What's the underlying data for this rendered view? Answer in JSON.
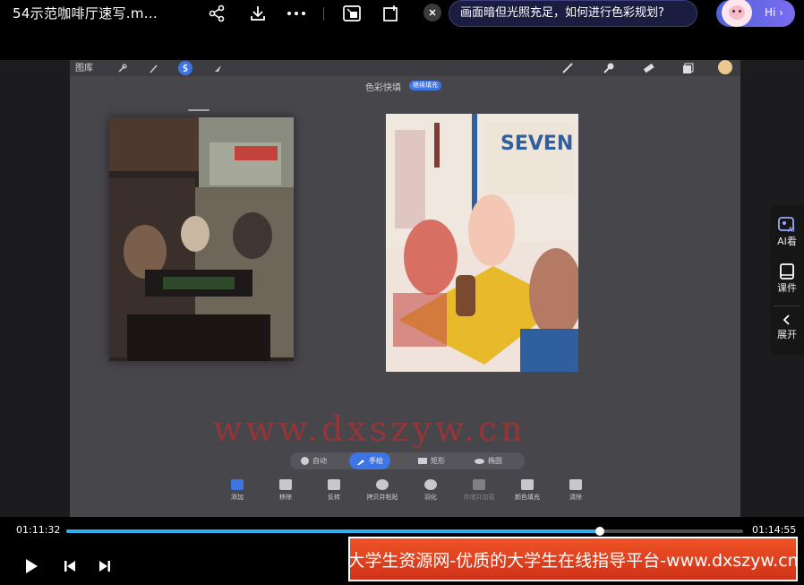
{
  "file_title": "54示范咖啡厅速写.m...",
  "toolbar_icons": [
    "share-icon",
    "download-icon",
    "more-icon",
    "crop-screen-icon",
    "rotate-icon"
  ],
  "ai_question": "画面暗但光照充足，如何进行色彩规划?",
  "hi_label": "Hi ›",
  "ipad": {
    "gallery_label": "图库",
    "heading": "色彩快填",
    "badge": "继续填充"
  },
  "watermark": "www.dxszyw.cn",
  "mode_bar": [
    {
      "label": "自动",
      "icon": "circle-icon"
    },
    {
      "label": "手绘",
      "icon": "pen-icon"
    },
    {
      "label": "矩形",
      "icon": "rectangle-icon"
    },
    {
      "label": "椭圆",
      "icon": "ellipse-icon"
    }
  ],
  "actions": [
    {
      "label": "添加",
      "icon": "add-icon"
    },
    {
      "label": "移除",
      "icon": "remove-icon"
    },
    {
      "label": "反转",
      "icon": "invert-icon"
    },
    {
      "label": "拷贝并粘贴",
      "icon": "copy-paste-icon"
    },
    {
      "label": "羽化",
      "icon": "feather-icon"
    },
    {
      "label": "存储并加载",
      "icon": "save-load-icon"
    },
    {
      "label": "颜色填充",
      "icon": "fill-icon"
    },
    {
      "label": "清除",
      "icon": "clear-icon"
    }
  ],
  "side_panel": {
    "ai_label": "AI看",
    "course_label": "课件",
    "expand_label": "展开"
  },
  "player": {
    "current_time": "01:11:32",
    "total_time": "01:14:55",
    "progress": 0.788
  },
  "banner": "大学生资源网-优质的大学生在线指导平台-www.dxszyw.cn",
  "colors": {
    "accent_blue": "#3d74e6",
    "progress": "#30b0ee",
    "banner": "#e64522"
  }
}
